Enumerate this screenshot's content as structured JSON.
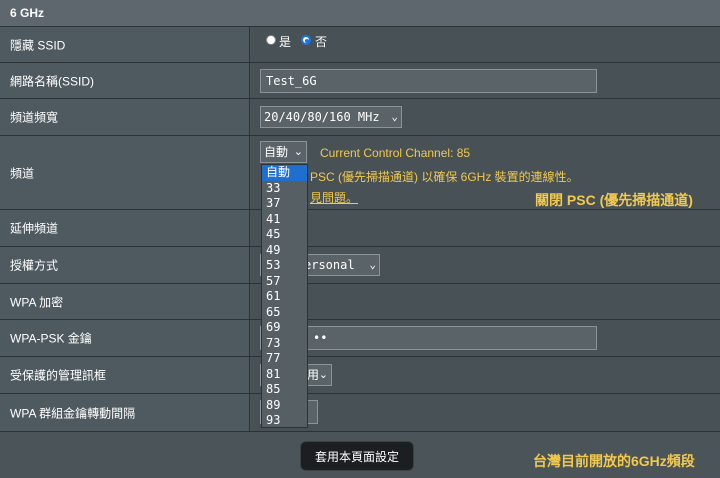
{
  "header": {
    "title": "6 GHz"
  },
  "rows": {
    "hide_ssid": {
      "label": "隱藏 SSID",
      "yes_label": "是",
      "no_label": "否"
    },
    "ssid": {
      "label": "網路名稱(SSID)",
      "value": "Test_6G"
    },
    "bandwidth": {
      "label": "頻道頻寬",
      "value": "20/40/80/160 MHz"
    },
    "channel": {
      "label": "頻道",
      "selected": "自動",
      "current_channel": "Current Control Channel: 85",
      "psc_note": "PSC (優先掃描通道) 以確保 6GHz 裝置的連線性。",
      "link_text": "見問題。"
    },
    "ext_channel": {
      "label": "延伸頻道"
    },
    "auth": {
      "label": "授權方式",
      "value": "ersonal"
    },
    "wpa_enc": {
      "label": "WPA 加密"
    },
    "wpa_psk": {
      "label": "WPA-PSK 金鑰",
      "value": "••"
    },
    "pmf": {
      "label": "受保護的管理訊框",
      "value": "用"
    },
    "group_key": {
      "label": "WPA 群組金鑰轉動間隔"
    }
  },
  "dropdown": {
    "options": [
      "自動",
      "33",
      "37",
      "41",
      "45",
      "49",
      "53",
      "57",
      "61",
      "65",
      "69",
      "73",
      "77",
      "81",
      "85",
      "89",
      "93"
    ],
    "selected_index": 0
  },
  "apply_button": {
    "label": "套用本頁面設定"
  },
  "annotations": {
    "psc_close": "關閉 PSC (優先掃描通道)",
    "taiwan_bands": "台灣目前開放的6GHz頻段"
  },
  "colors": {
    "accent_yellow": "#f2c94c",
    "selection_blue": "#1f6fd1"
  }
}
